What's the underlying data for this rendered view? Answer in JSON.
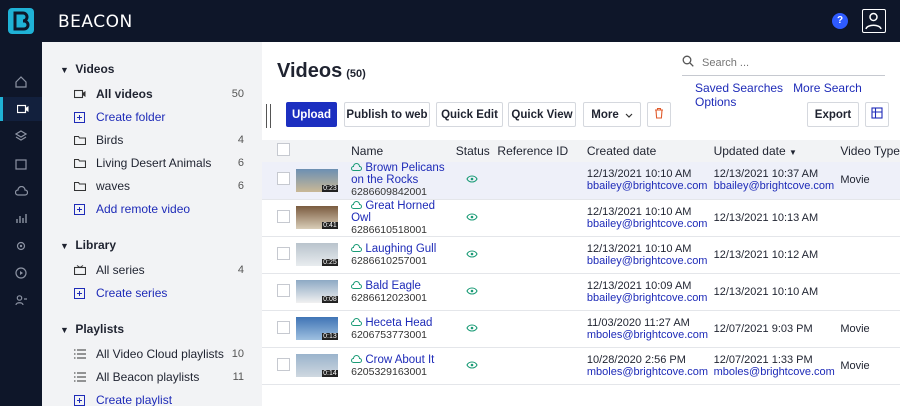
{
  "app": {
    "brand": "BEACON",
    "help_label": "?"
  },
  "sidebar": {
    "videos_heading": "Videos",
    "videos_items": [
      {
        "label": "All videos",
        "count": "50"
      },
      {
        "label": "Create folder"
      },
      {
        "label": "Birds",
        "count": "4"
      },
      {
        "label": "Living Desert Animals",
        "count": "6"
      },
      {
        "label": "waves",
        "count": "6"
      },
      {
        "label": "Add remote video"
      }
    ],
    "library_heading": "Library",
    "library_items": [
      {
        "label": "All series",
        "count": "4"
      },
      {
        "label": "Create series"
      }
    ],
    "playlists_heading": "Playlists",
    "playlist_items": [
      {
        "label": "All Video Cloud playlists",
        "count": "10"
      },
      {
        "label": "All Beacon playlists",
        "count": "11"
      },
      {
        "label": "Create playlist"
      }
    ]
  },
  "main": {
    "title": "Videos",
    "count": "(50)",
    "search_placeholder": "Search ...",
    "saved_searches": "Saved Searches",
    "more_search": "More Search Options",
    "toolbar": {
      "upload": "Upload",
      "publish": "Publish to web",
      "quick_edit": "Quick Edit",
      "quick_view": "Quick View",
      "more": "More",
      "export": "Export"
    }
  },
  "table": {
    "columns": [
      "Name",
      "Status",
      "Reference ID",
      "Created date",
      "Updated date",
      "Video Type"
    ],
    "rows": [
      {
        "name": "Brown Pelicans on the Rocks",
        "id": "6286609842001",
        "duration": "0:23",
        "created": "12/13/2021 10:10 AM",
        "created_by": "bbailey@brightcove.com",
        "updated": "12/13/2021 10:37 AM",
        "updated_by": "bbailey@brightcove.com",
        "type": "Movie"
      },
      {
        "name": "Great Horned Owl",
        "id": "6286610518001",
        "duration": "0:41",
        "created": "12/13/2021 10:10 AM",
        "created_by": "bbailey@brightcove.com",
        "updated": "12/13/2021 10:13 AM",
        "updated_by": "",
        "type": ""
      },
      {
        "name": "Laughing Gull",
        "id": "6286610257001",
        "duration": "0:25",
        "created": "12/13/2021 10:10 AM",
        "created_by": "bbailey@brightcove.com",
        "updated": "12/13/2021 10:12 AM",
        "updated_by": "",
        "type": ""
      },
      {
        "name": "Bald Eagle",
        "id": "6286612023001",
        "duration": "0:08",
        "created": "12/13/2021 10:09 AM",
        "created_by": "bbailey@brightcove.com",
        "updated": "12/13/2021 10:10 AM",
        "updated_by": "",
        "type": ""
      },
      {
        "name": "Heceta Head",
        "id": "6206753773001",
        "duration": "0:13",
        "created": "11/03/2020 11:27 AM",
        "created_by": "mboles@brightcove.com",
        "updated": "12/07/2021 9:03 PM",
        "updated_by": "",
        "type": "Movie"
      },
      {
        "name": "Crow About It",
        "id": "6205329163001",
        "duration": "0:14",
        "created": "10/28/2020 2:56 PM",
        "created_by": "mboles@brightcove.com",
        "updated": "12/07/2021 1:33 PM",
        "updated_by": "mboles@brightcove.com",
        "type": "Movie"
      }
    ]
  },
  "colors": {
    "nav_bg": "#0e1629",
    "accent": "#1c2fc0",
    "link": "#1e2bb8",
    "status": "#1a9b76"
  }
}
